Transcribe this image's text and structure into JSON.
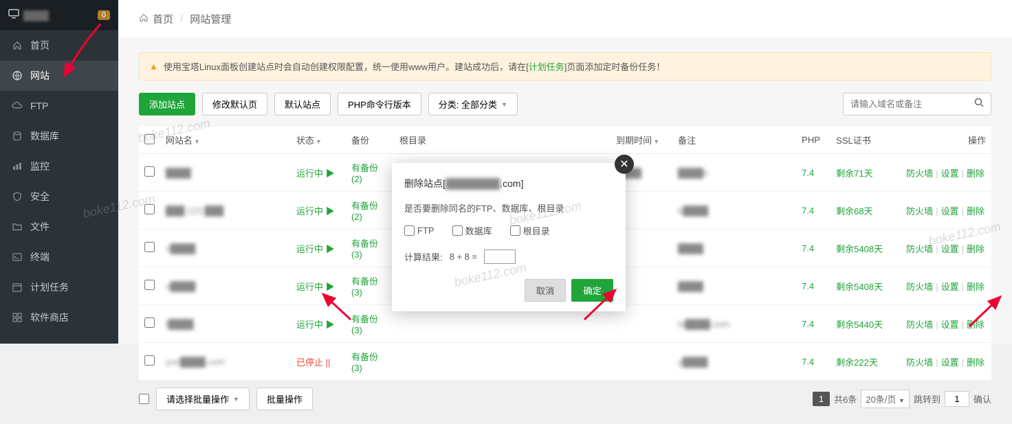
{
  "sidebar": {
    "logo_text": "████",
    "badge": "0",
    "items": [
      {
        "icon": "home",
        "label": "首页"
      },
      {
        "icon": "globe",
        "label": "网站"
      },
      {
        "icon": "cloud",
        "label": "FTP"
      },
      {
        "icon": "database",
        "label": "数据库"
      },
      {
        "icon": "chart",
        "label": "监控"
      },
      {
        "icon": "shield",
        "label": "安全"
      },
      {
        "icon": "folder",
        "label": "文件"
      },
      {
        "icon": "terminal",
        "label": "终端"
      },
      {
        "icon": "calendar",
        "label": "计划任务"
      },
      {
        "icon": "grid",
        "label": "软件商店"
      }
    ]
  },
  "breadcrumb": {
    "home": "首页",
    "current": "网站管理"
  },
  "alert": {
    "pre": "使用宝塔Linux面板创建站点时会自动创建权限配置，统一使用www用户。建站成功后，请在[",
    "link": "计划任务",
    "post": "]页面添加定时备份任务！"
  },
  "toolbar": {
    "add": "添加站点",
    "modify_default": "修改默认页",
    "default_site": "默认站点",
    "php_cli": "PHP命令行版本",
    "category": "分类: 全部分类",
    "search_ph": "请输入域名或备注"
  },
  "table": {
    "headers": {
      "name": "网站名",
      "status": "状态",
      "backup": "备份",
      "root": "根目录",
      "expire": "到期时间",
      "remark": "备注",
      "php": "PHP",
      "ssl": "SSL证书",
      "ops": "操作"
    },
    "rows": [
      {
        "name": "████",
        "status": "运行中",
        "status_cls": "running",
        "status_icon": "▶",
        "backup": "有备份(2)",
        "root": "████",
        "expire": "████",
        "remark": "████n",
        "php": "7.4",
        "ssl": "剩余71天"
      },
      {
        "name": "███ 123 ███",
        "status": "运行中",
        "status_cls": "running",
        "status_icon": "▶",
        "backup": "有备份(2)",
        "root": "",
        "expire": "",
        "remark": "b████",
        "php": "7.4",
        "ssl": "剩余68天"
      },
      {
        "name": "v████",
        "status": "运行中",
        "status_cls": "running",
        "status_icon": "▶",
        "backup": "有备份(3)",
        "root": "",
        "expire": "",
        "remark": "████",
        "php": "7.4",
        "ssl": "剩余5408天"
      },
      {
        "name": "s████",
        "status": "运行中",
        "status_cls": "running",
        "status_icon": "▶",
        "backup": "有备份(3)",
        "root": "",
        "expire": "",
        "remark": "████",
        "php": "7.4",
        "ssl": "剩余5408天"
      },
      {
        "name": "t████",
        "status": "运行中",
        "status_cls": "running",
        "status_icon": "▶",
        "backup": "有备份(3)",
        "root": "",
        "expire": "",
        "remark": "la████.com",
        "php": "7.4",
        "ssl": "剩余5440天"
      },
      {
        "name": "yun████.com",
        "status": "已停止",
        "status_cls": "stopped",
        "status_icon": "||",
        "backup": "有备份(3)",
        "root": "",
        "expire": "",
        "remark": "y████",
        "php": "7.4",
        "ssl": "剩余222天"
      }
    ],
    "action": {
      "firewall": "防火墙",
      "settings": "设置",
      "delete": "删除"
    }
  },
  "footer": {
    "batch_ph": "请选择批量操作",
    "batch_btn": "批量操作",
    "total": "共6条",
    "per_page": "20条/页",
    "jump": "跳转到",
    "page": "1",
    "confirm": "确认"
  },
  "modal": {
    "title_pre": "删除站点[",
    "title_domain": "████████",
    "title_suf": ".com]",
    "question": "是否要删除同名的FTP、数据库、根目录",
    "opt_ftp": "FTP",
    "opt_db": "数据库",
    "opt_root": "根目录",
    "calc_label": "计算结果:",
    "calc_expr": "8 + 8  =",
    "cancel": "取消",
    "ok": "确定"
  },
  "watermark": "boke112.com"
}
